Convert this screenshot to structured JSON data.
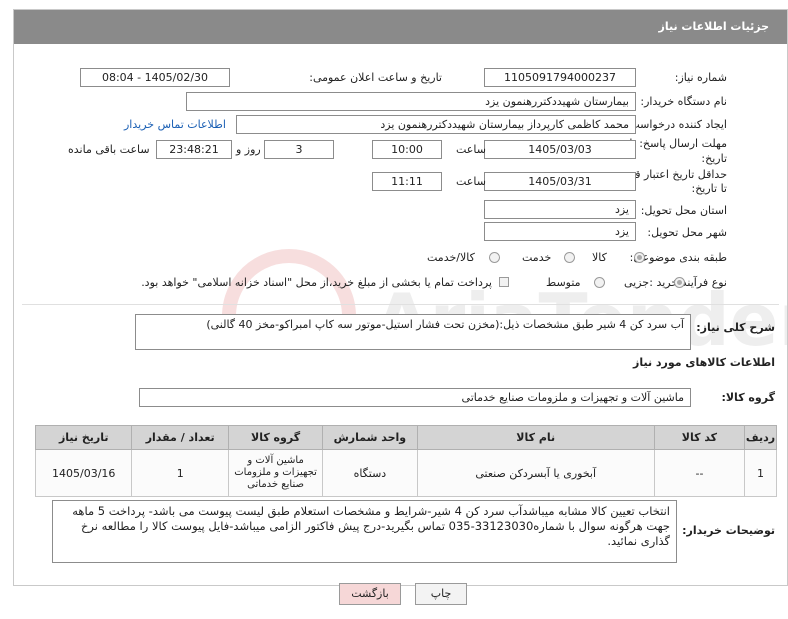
{
  "header": {
    "title": "جزئیات اطلاعات نیاز"
  },
  "form": {
    "need_number_label": "شماره نیاز:",
    "need_number": "1105091794000237",
    "announce_label": "تاریخ و ساعت اعلان عمومی:",
    "announce_value": "1405/02/30 - 08:04",
    "buyer_org_label": "نام دستگاه خریدار:",
    "buyer_org": "بیمارستان شهیددکتررهنمون یزد",
    "creator_label": "ایجاد کننده درخواست:",
    "creator": "محمد کاظمی کارپرداز بیمارستان شهیددکتررهنمون یزد",
    "buyer_contact_link": "اطلاعات تماس خریدار",
    "deadline_label_1": "مهلت ارسال پاسخ: تا",
    "deadline_label_2": "تاریخ:",
    "deadline_date": "1405/03/03",
    "time_label": "ساعت",
    "deadline_time": "10:00",
    "days_value": "3",
    "days_label": "روز و",
    "remaining_time": "23:48:21",
    "remaining_label": "ساعت باقی مانده",
    "price_valid_label_1": "حداقل تاریخ اعتبار قیمت:",
    "price_valid_label_2": "تا تاریخ:",
    "price_valid_date": "1405/03/31",
    "price_valid_time": "11:11",
    "province_label": "استان محل تحویل:",
    "province": "یزد",
    "city_label": "شهر محل تحویل:",
    "city": "یزد",
    "category_label": "طبقه بندی موضوعی:",
    "category_options": [
      "کالا",
      "خدمت",
      "کالا/خدمت"
    ],
    "category_selected": "کالا",
    "process_label": "نوع فرآیند خرید :",
    "process_options": [
      "جزیی",
      "متوسط"
    ],
    "process_selected": "جزیی",
    "payment_note": "پرداخت تمام یا بخشی از مبلغ خرید،از محل \"اسناد خزانه اسلامی\" خواهد بود."
  },
  "description": {
    "label": "شرح کلی نیاز:",
    "text": "آب سرد کن 4 شیر طبق مشخصات ذیل:(مخزن تحت فشار استیل-موتور سه کاپ امبراکو-مخز 40 گالنی)"
  },
  "goods": {
    "section_title": "اطلاعات کالاهای مورد نیاز",
    "group_label": "گروه کالا:",
    "group_value": "ماشین آلات و تجهیزات و ملزومات صنایع خدماتی",
    "columns": [
      "ردیف",
      "کد کالا",
      "نام کالا",
      "واحد شمارش",
      "گروه کالا",
      "تعداد / مقدار",
      "تاریخ نیاز"
    ],
    "rows": [
      {
        "row": "1",
        "code": "--",
        "name": "آبخوری یا آبسردکن صنعتی",
        "unit": "دستگاه",
        "group": "ماشین آلات و تجهیزات و ملزومات صنایع خدماتی",
        "qty": "1",
        "date": "1405/03/16"
      }
    ]
  },
  "buyer_notes": {
    "label": "توضیحات خریدار:",
    "text": "انتخاب تعیین کالا مشابه میباشدآب سرد کن 4 شیر-شرایط و مشخصات استعلام طبق لیست پیوست می باشد- پرداخت 5 ماهه جهت هرگونه سوال با شماره33123030-035 تماس بگیرید-درج پیش فاکتور الزامی میباشد-فایل پیوست کالا را مطالعه نرخ گذاری نمائید."
  },
  "buttons": {
    "back": "بازگشت",
    "print": "چاپ"
  },
  "watermark": {
    "text": "AriaTender.net"
  },
  "colors": {
    "header_bg": "#8a8a8a",
    "link": "#1a5fb4",
    "back_button": "#f6d7d7",
    "table_header": "#d4d4d4"
  }
}
